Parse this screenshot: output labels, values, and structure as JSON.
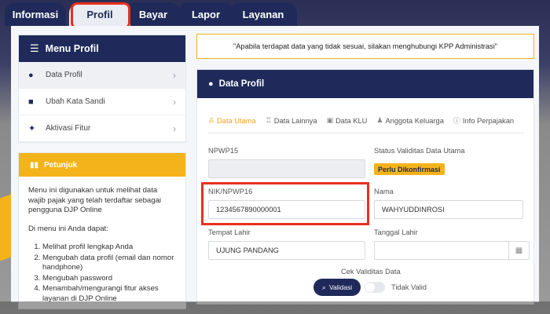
{
  "tabs": [
    {
      "label": "Informasi"
    },
    {
      "label": "Profil"
    },
    {
      "label": "Bayar"
    },
    {
      "label": "Lapor"
    },
    {
      "label": "Layanan"
    }
  ],
  "menu": {
    "title": "Menu Profil",
    "items": [
      {
        "label": "Data Profil",
        "icon": "user-icon"
      },
      {
        "label": "Ubah Kata Sandi",
        "icon": "lock-icon"
      },
      {
        "label": "Aktivasi Fitur",
        "icon": "pin-icon"
      }
    ]
  },
  "guide": {
    "title": "Petunjuk",
    "intro": "Menu ini digunakan untuk melihat data wajib pajak yang telah terdaftar sebagai pengguna DJP Online",
    "lead": "Di menu ini Anda dapat:",
    "steps": [
      "Melihat profil lengkap Anda",
      "Mengubah data profil (email dan nomor handphone)",
      "Mengubah password",
      "Menambah/mengurangi fitur akses layanan di DJP Online"
    ]
  },
  "notice": "\"Apabila terdapat data yang tidak sesuai, silakan menghubungi KPP Administrasi\"",
  "profile": {
    "title": "Data Profil",
    "subtabs": [
      {
        "label": "Data Utama",
        "icon": "person-icon"
      },
      {
        "label": "Data Lainnya",
        "icon": "sitemap-icon"
      },
      {
        "label": "Data KLU",
        "icon": "box-icon"
      },
      {
        "label": "Anggota Keluarga",
        "icon": "users-icon"
      },
      {
        "label": "Info Perpajakan",
        "icon": "info-icon"
      }
    ],
    "npwp15_label": "NPWP15",
    "npwp15_value": "",
    "status_label": "Status Validitas Data Utama",
    "status_badge": "Perlu Dikonfirmasi",
    "nik_label": "NIK/NPWP16",
    "nik_value": "1234567890000001",
    "nama_label": "Nama",
    "nama_value": "WAHYUDDINROSI",
    "tempat_label": "Tempat Lahir",
    "tempat_value": "UJUNG PANDANG",
    "tanggal_label": "Tanggal Lahir",
    "tanggal_value": "",
    "cek_label": "Cek Validitas Data",
    "validasi_label": "Validasi",
    "tidak_valid_label": "Tidak Valid"
  },
  "colors": {
    "navy": "#1f2a5a",
    "accent": "#f5b31b",
    "highlight": "#e8301e"
  }
}
